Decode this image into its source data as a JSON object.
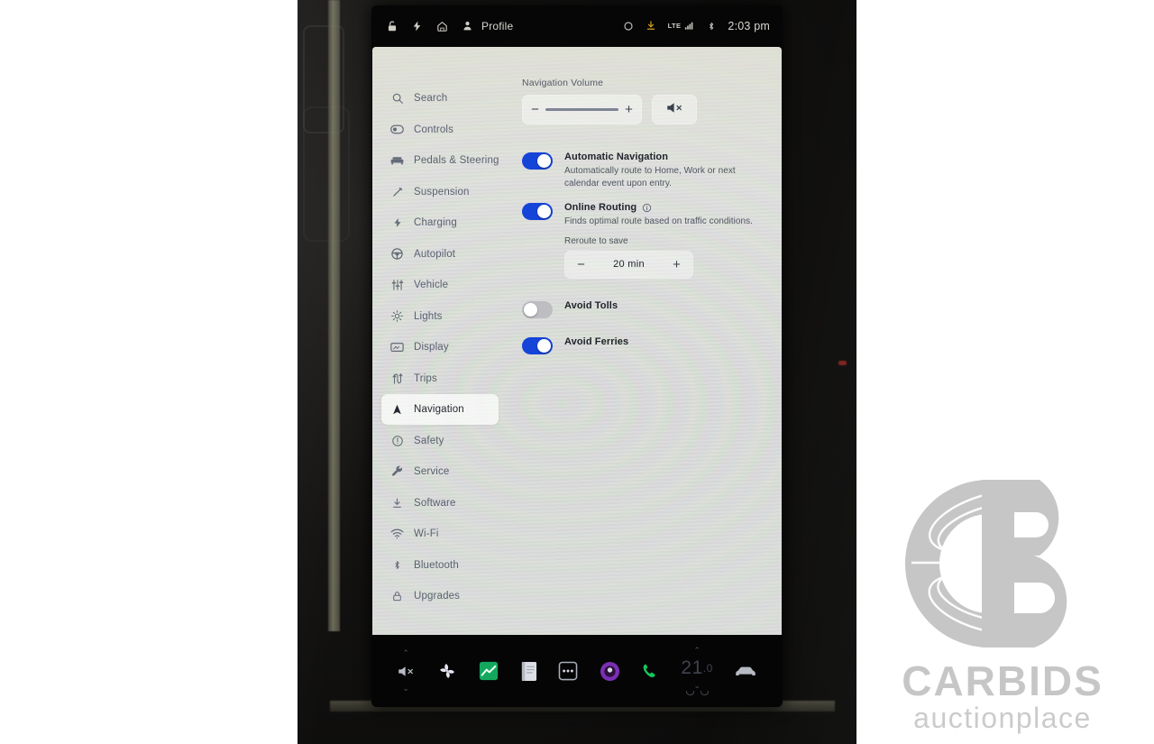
{
  "statusbar": {
    "left_icons": [
      "lock-icon",
      "bolt-icon",
      "home-icon",
      "profile-icon"
    ],
    "profile_label": "Profile",
    "right_icons": [
      "circle-icon",
      "download-icon",
      "signal-icon",
      "bluetooth-icon"
    ],
    "network_label": "LTE",
    "clock": "2:03 pm"
  },
  "sidebar": {
    "items": [
      {
        "label": "Search",
        "icon": "search-icon",
        "active": false
      },
      {
        "label": "Controls",
        "icon": "toggle-icon",
        "active": false
      },
      {
        "label": "Pedals & Steering",
        "icon": "car-seat-icon",
        "active": false
      },
      {
        "label": "Suspension",
        "icon": "suspension-icon",
        "active": false
      },
      {
        "label": "Charging",
        "icon": "bolt-icon",
        "active": false
      },
      {
        "label": "Autopilot",
        "icon": "steering-icon",
        "active": false
      },
      {
        "label": "Vehicle",
        "icon": "sliders-icon",
        "active": false
      },
      {
        "label": "Lights",
        "icon": "lights-icon",
        "active": false
      },
      {
        "label": "Display",
        "icon": "display-icon",
        "active": false
      },
      {
        "label": "Trips",
        "icon": "trips-icon",
        "active": false
      },
      {
        "label": "Navigation",
        "icon": "navigation-icon",
        "active": true
      },
      {
        "label": "Safety",
        "icon": "safety-icon",
        "active": false
      },
      {
        "label": "Service",
        "icon": "wrench-icon",
        "active": false
      },
      {
        "label": "Software",
        "icon": "download-icon",
        "active": false
      },
      {
        "label": "Wi-Fi",
        "icon": "wifi-icon",
        "active": false
      },
      {
        "label": "Bluetooth",
        "icon": "bluetooth-icon",
        "active": false
      },
      {
        "label": "Upgrades",
        "icon": "lock-icon",
        "active": false
      }
    ]
  },
  "content": {
    "volume": {
      "title": "Navigation Volume",
      "minus_label": "−",
      "plus_label": "+",
      "mute_icon": "mute-icon",
      "level_percent": 100
    },
    "settings": [
      {
        "id": "automatic-navigation",
        "title": "Automatic Navigation",
        "description": "Automatically route to Home, Work or next calendar event upon entry.",
        "state": "on",
        "info": false
      },
      {
        "id": "online-routing",
        "title": "Online Routing",
        "description": "Finds optimal route based on traffic conditions.",
        "state": "on",
        "info": true
      },
      {
        "id": "avoid-tolls",
        "title": "Avoid Tolls",
        "description": "",
        "state": "off",
        "info": false
      },
      {
        "id": "avoid-ferries",
        "title": "Avoid Ferries",
        "description": "",
        "state": "on",
        "info": false
      }
    ],
    "reroute": {
      "label": "Reroute to save",
      "value": "20  min",
      "minus_label": "−",
      "plus_label": "+"
    }
  },
  "taskbar": {
    "volume": {
      "icon": "mute-icon",
      "up": "⌃",
      "down": "⌄"
    },
    "apps": [
      {
        "id": "climate-fan",
        "icon": "fan-icon",
        "color": "#e9e9f2"
      },
      {
        "id": "energy",
        "icon": "energy-icon",
        "color": "#13a85e"
      },
      {
        "id": "notes",
        "icon": "notes-icon",
        "color": "#d9dce2"
      },
      {
        "id": "more",
        "icon": "more-icon",
        "color": "#c9ccd4"
      },
      {
        "id": "media",
        "icon": "media-icon",
        "color": "#7b2fb5"
      },
      {
        "id": "phone",
        "icon": "phone-icon",
        "color": "#14c55c"
      }
    ],
    "temperature": {
      "value": "21",
      "decimal": ".0",
      "up": "⌃",
      "down": "⌄"
    },
    "vehicle_icon": "car-icon"
  },
  "watermark": {
    "logo": "cb-fingerprint-logo",
    "name": "CARBIDS",
    "tagline": "auctionplace",
    "color": "#c4c4c4"
  }
}
